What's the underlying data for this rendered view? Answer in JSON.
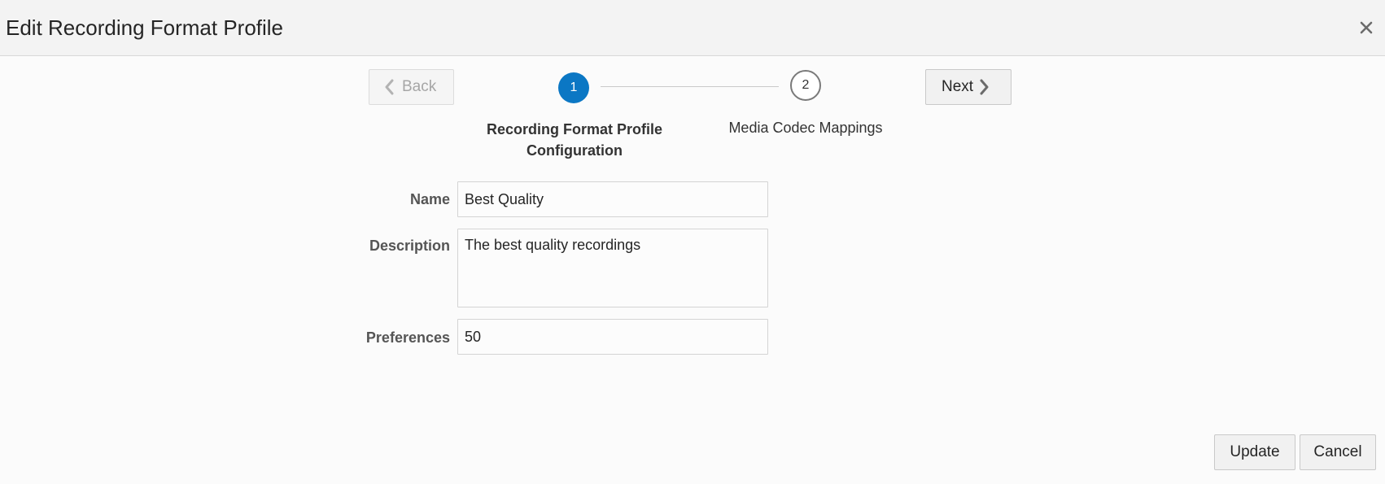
{
  "dialog": {
    "title": "Edit Recording Format Profile",
    "close_icon": "close-icon"
  },
  "train": {
    "back_label": "Back",
    "next_label": "Next",
    "current_step": 1,
    "steps": [
      {
        "number": "1",
        "label": "Recording Format Profile Configuration",
        "state": "active"
      },
      {
        "number": "2",
        "label": "Media Codec Mappings",
        "state": "inactive"
      }
    ]
  },
  "form": {
    "name": {
      "label": "Name",
      "value": "Best Quality"
    },
    "description": {
      "label": "Description",
      "value": "The best quality recordings"
    },
    "preferences": {
      "label": "Preferences",
      "value": "50"
    }
  },
  "footer": {
    "update_label": "Update",
    "cancel_label": "Cancel"
  },
  "colors": {
    "accent": "#0b77c4",
    "header_bg": "#f3f3f3",
    "page_bg": "#fbfbfb"
  }
}
